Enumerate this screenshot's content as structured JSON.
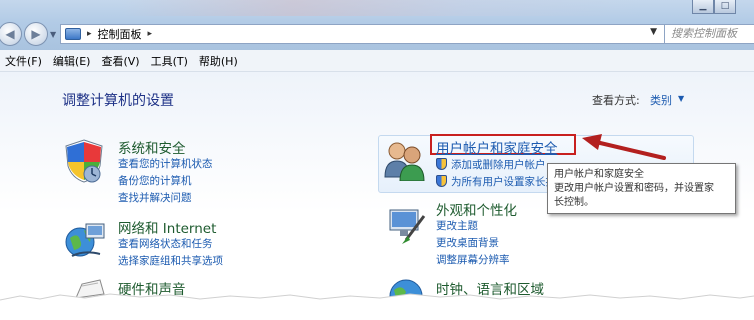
{
  "window": {
    "minimize_glyph": "▁",
    "maximize_glyph": "□"
  },
  "address": {
    "icon": "control-panel-icon",
    "path": "控制面板",
    "separator": "▸",
    "refresh_glyph": "↻"
  },
  "search": {
    "placeholder": "搜索控制面板"
  },
  "menu": {
    "items": [
      "文件(F)",
      "编辑(E)",
      "查看(V)",
      "工具(T)",
      "帮助(H)"
    ]
  },
  "page": {
    "title": "调整计算机的设置",
    "view_label": "查看方式:",
    "view_value": "类别",
    "view_caret": "▼"
  },
  "categories": {
    "system": {
      "title": "系统和安全",
      "icon": "shield-icon",
      "links": [
        "查看您的计算机状态",
        "备份您的计算机",
        "查找并解决问题"
      ]
    },
    "network": {
      "title": "网络和 Internet",
      "icon": "network-globe-icon",
      "links": [
        "查看网络状态和任务",
        "选择家庭组和共享选项"
      ]
    },
    "hardware": {
      "title": "硬件和声音",
      "icon": "printer-icon"
    },
    "users": {
      "title": "用户帐户和家庭安全",
      "icon": "users-icon",
      "links": [
        "添加或删除用户帐户",
        "为所有用户设置家长控制"
      ]
    },
    "appearance": {
      "title": "外观和个性化",
      "icon": "monitor-brush-icon",
      "links": [
        "更改主题",
        "更改桌面背景",
        "调整屏幕分辨率"
      ]
    },
    "clock": {
      "title": "时钟、语言和区域",
      "icon": "globe-clock-icon"
    }
  },
  "tooltip": {
    "line1": "用户帐户和家庭安全",
    "line2": "更改用户帐户设置和密码，并设置家",
    "line3": "长控制。"
  },
  "colors": {
    "highlight_border": "#c8201f",
    "link": "#1c5bb0",
    "category_title": "#1e5b2f",
    "page_title": "#1e3287"
  }
}
